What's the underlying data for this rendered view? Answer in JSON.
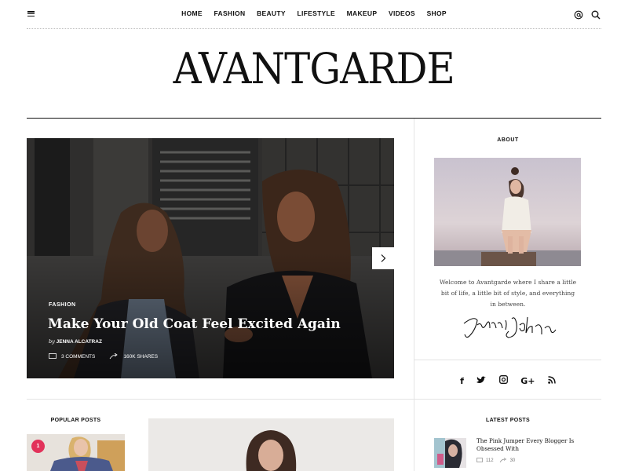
{
  "nav": {
    "items": [
      "HOME",
      "FASHION",
      "BEAUTY",
      "LIFESTYLE",
      "MAKEUP",
      "VIDEOS",
      "SHOP"
    ],
    "icons": [
      "menu-icon",
      "at-icon",
      "search-icon"
    ]
  },
  "logo": {
    "text": "AVANTGARDE"
  },
  "hero": {
    "category": "FASHION",
    "title": "Make Your Old Coat Feel Excited Again",
    "by_prefix": "by",
    "author": "JENNA ALCATRAZ",
    "comments": "3 COMMENTS",
    "shares": "160K SHARES"
  },
  "about": {
    "heading": "ABOUT",
    "text": "Welcome to Avantgarde where I share a little bit of life, a little bit of style, and everything in between.",
    "signature_text": "Jerri Johnson"
  },
  "social": {
    "icons": [
      "f",
      "t",
      "◎",
      "G+",
      "rss"
    ]
  },
  "popular": {
    "heading": "POPULAR POSTS",
    "badge": "1"
  },
  "latest": {
    "heading": "LATEST POSTS",
    "title": "The Pink Jumper Every Blogger Is Obsessed With",
    "comments": "112",
    "shares": "30"
  },
  "colors": {
    "accent": "#e2325a",
    "text": "#111111",
    "muted": "#777777"
  }
}
